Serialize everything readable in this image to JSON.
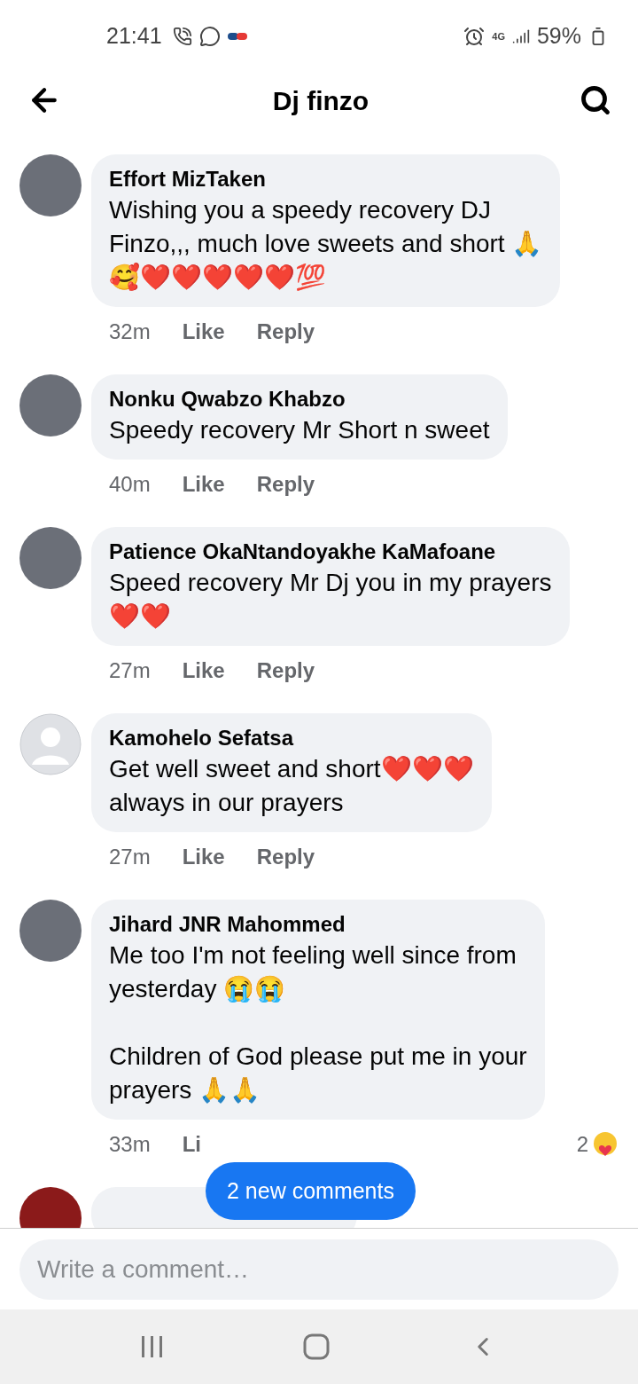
{
  "status_bar": {
    "time": "21:41",
    "network": "4G",
    "battery": "59%"
  },
  "header": {
    "title": "Dj finzo"
  },
  "comments": [
    {
      "name": "Effort MizTaken",
      "text": "Wishing you a speedy recovery DJ\nFinzo,,, much love sweets and short 🙏\n🥰❤️❤️❤️❤️❤️💯",
      "time": "32m",
      "like": "Like",
      "reply": "Reply",
      "avatar": {
        "kind": "photo"
      }
    },
    {
      "name": "Nonku Qwabzo Khabzo",
      "text": "Speedy recovery Mr Short n sweet",
      "time": "40m",
      "like": "Like",
      "reply": "Reply",
      "avatar": {
        "kind": "photo"
      }
    },
    {
      "name": "Patience OkaNtandoyakhe KaMafoane",
      "text": "Speed recovery Mr Dj you in my prayers\n❤️❤️",
      "time": "27m",
      "like": "Like",
      "reply": "Reply",
      "avatar": {
        "kind": "photo"
      }
    },
    {
      "name": "Kamohelo Sefatsa",
      "text": "Get well sweet and short❤️❤️❤️\nalways in our prayers",
      "time": "27m",
      "like": "Like",
      "reply": "Reply",
      "avatar": {
        "kind": "default"
      }
    },
    {
      "name": "Jihard JNR Mahommed",
      "text": "Me too I'm not feeling well since from\nyesterday 😭😭\n\nChildren of God please put me in your\nprayers 🙏🙏",
      "time": "33m",
      "like": "Li",
      "reaction_count": "2",
      "avatar": {
        "kind": "photo"
      }
    }
  ],
  "new_comments_button": "2 new comments",
  "comment_field": {
    "placeholder": "Write a comment…"
  }
}
